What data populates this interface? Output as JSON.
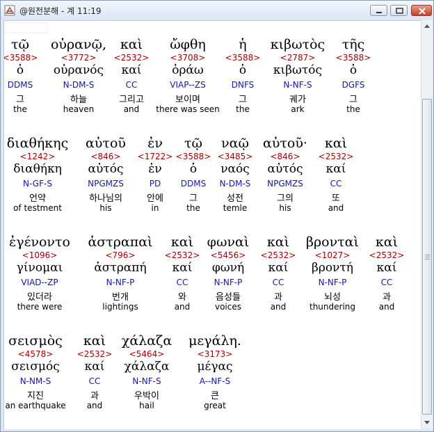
{
  "window": {
    "title": "@원전분해 - 계 11:19",
    "icon": "app-book-icon",
    "colors": {
      "strong": "#a00000",
      "parse": "#1515b0"
    }
  },
  "lines": [
    {
      "words": [
        {
          "greek": "τῷ",
          "strong": "<3588>",
          "lemma": "ὁ",
          "parse": "DDMS",
          "korean": "그",
          "english": "the"
        },
        {
          "greek": "οὐρανῷ,",
          "strong": "<3772>",
          "lemma": "οὐρανός",
          "parse": "N-DM-S",
          "korean": "하늘",
          "english": "heaven"
        },
        {
          "greek": "καὶ",
          "strong": "<2532>",
          "lemma": "καί",
          "parse": "CC",
          "korean": "그리고",
          "english": "and"
        },
        {
          "greek": "ὤφθη",
          "strong": "<3708>",
          "lemma": "ὁράω",
          "parse": "VIAP--ZS",
          "korean": "보이며",
          "english": "there was seen"
        },
        {
          "greek": "ἡ",
          "strong": "<3588>",
          "lemma": "ὁ",
          "parse": "DNFS",
          "korean": "그",
          "english": "the"
        },
        {
          "greek": "κιβωτὸς",
          "strong": "<2787>",
          "lemma": "κιβωτός",
          "parse": "N-NF-S",
          "korean": "궤가",
          "english": "ark"
        },
        {
          "greek": "τῆς",
          "strong": "<3588>",
          "lemma": "ὁ",
          "parse": "DGFS",
          "korean": "그",
          "english": "the"
        }
      ]
    },
    {
      "words": [
        {
          "greek": "διαθήκης",
          "strong": "<1242>",
          "lemma": "διαθήκη",
          "parse": "N-GF-S",
          "korean": "언약",
          "english": "of testment"
        },
        {
          "greek": "αὐτοῦ",
          "strong": "<846>",
          "lemma": "αὐτός",
          "parse": "NPGMZS",
          "korean": "하나님의",
          "english": "his"
        },
        {
          "greek": "ἐν",
          "strong": "<1722>",
          "lemma": "ἐν",
          "parse": "PD",
          "korean": "안에",
          "english": "in"
        },
        {
          "greek": "τῷ",
          "strong": "<3588>",
          "lemma": "ὁ",
          "parse": "DDMS",
          "korean": "그",
          "english": "the"
        },
        {
          "greek": "ναῷ",
          "strong": "<3485>",
          "lemma": "ναός",
          "parse": "N-DM-S",
          "korean": "성전",
          "english": "temle"
        },
        {
          "greek": "αὐτοῦ·",
          "strong": "<846>",
          "lemma": "αὐτός",
          "parse": "NPGMZS",
          "korean": "그의",
          "english": "his"
        },
        {
          "greek": "καὶ",
          "strong": "<2532>",
          "lemma": "καί",
          "parse": "CC",
          "korean": "또",
          "english": "and"
        }
      ]
    },
    {
      "words": [
        {
          "greek": "ἐγένοντο",
          "strong": "<1096>",
          "lemma": "γίνομαι",
          "parse": "VIAD--ZP",
          "korean": "있더라",
          "english": "there were"
        },
        {
          "greek": "ἀστραπαὶ",
          "strong": "<796>",
          "lemma": "ἀστραπή",
          "parse": "N-NF-P",
          "korean": "번개",
          "english": "lightings"
        },
        {
          "greek": "καὶ",
          "strong": "<2532>",
          "lemma": "καί",
          "parse": "CC",
          "korean": "와",
          "english": "and"
        },
        {
          "greek": "φωναὶ",
          "strong": "<5456>",
          "lemma": "φωνή",
          "parse": "N-NF-P",
          "korean": "음성들",
          "english": "voices"
        },
        {
          "greek": "καὶ",
          "strong": "<2532>",
          "lemma": "καί",
          "parse": "CC",
          "korean": "과",
          "english": "and"
        },
        {
          "greek": "βρονταὶ",
          "strong": "<1027>",
          "lemma": "βροντή",
          "parse": "N-NF-P",
          "korean": "뇌성",
          "english": "thundering"
        },
        {
          "greek": "καὶ",
          "strong": "<2532>",
          "lemma": "καί",
          "parse": "CC",
          "korean": "과",
          "english": "and"
        }
      ]
    },
    {
      "words": [
        {
          "greek": "σεισμὸς",
          "strong": "<4578>",
          "lemma": "σεισμός",
          "parse": "N-NM-S",
          "korean": "지진",
          "english": "an earthquake"
        },
        {
          "greek": "καὶ",
          "strong": "<2532>",
          "lemma": "καί",
          "parse": "CC",
          "korean": "과",
          "english": "and"
        },
        {
          "greek": "χάλαζα",
          "strong": "<5464>",
          "lemma": "χάλαζα",
          "parse": "N-NF-S",
          "korean": "우박이",
          "english": "hail"
        },
        {
          "greek": "μεγάλη.",
          "strong": "<3173>",
          "lemma": "μέγας",
          "parse": "A--NF-S",
          "korean": "큰",
          "english": "great"
        }
      ]
    }
  ]
}
